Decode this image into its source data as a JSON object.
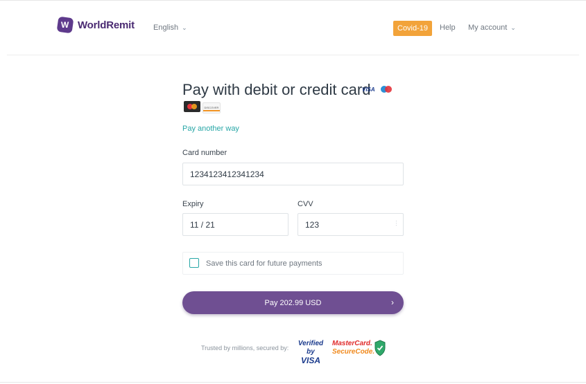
{
  "header": {
    "brand": "WorldRemit",
    "logo_letter": "W",
    "language": "English",
    "covid_label": "Covid-19",
    "help_label": "Help",
    "account_label": "My account"
  },
  "form": {
    "title": "Pay with debit or credit card",
    "card_brands": [
      "VISA",
      "Maestro",
      "MasterCard",
      "Discover"
    ],
    "visa_mark": "VISA",
    "discover_mark": "DISCOVER",
    "pay_another_way": "Pay another way",
    "card_number_label": "Card number",
    "card_number_value": "1234123412341234",
    "expiry_label": "Expiry",
    "expiry_value": "11 / 21",
    "cvv_label": "CVV",
    "cvv_value": "123",
    "save_card_label": "Save this card for future payments",
    "save_card_checked": false,
    "pay_button_label": "Pay 202.99 USD"
  },
  "footer": {
    "trusted_text": "Trusted by millions, secured by:",
    "verified_line1": "Verified by",
    "verified_line2": "VISA",
    "securecode_line1": "MasterCard.",
    "securecode_line2": "SecureCode."
  },
  "colors": {
    "brand_purple": "#5e3a8c",
    "button_purple": "#6f4f92",
    "covid_orange": "#f2a33a",
    "link_teal": "#27a6a6"
  }
}
